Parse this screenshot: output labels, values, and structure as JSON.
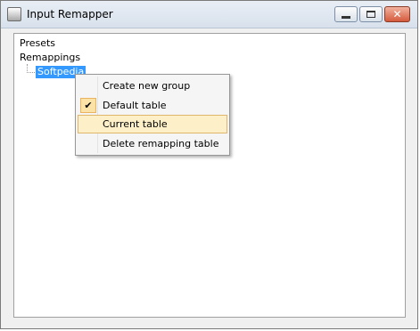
{
  "window": {
    "title": "Input Remapper"
  },
  "tree": {
    "presets": "Presets",
    "remappings": "Remappings",
    "selected_child": "Softpedia"
  },
  "context_menu": {
    "items": [
      {
        "label": "Create new group",
        "checked": false
      },
      {
        "label": "Default table",
        "checked": true
      },
      {
        "label": "Current table",
        "checked": false,
        "highlighted": true
      },
      {
        "label": "Delete remapping table",
        "checked": false
      }
    ],
    "check_glyph": "✔"
  },
  "colors": {
    "selection": "#3399ff",
    "menu_highlight": "#fdf0c8"
  }
}
